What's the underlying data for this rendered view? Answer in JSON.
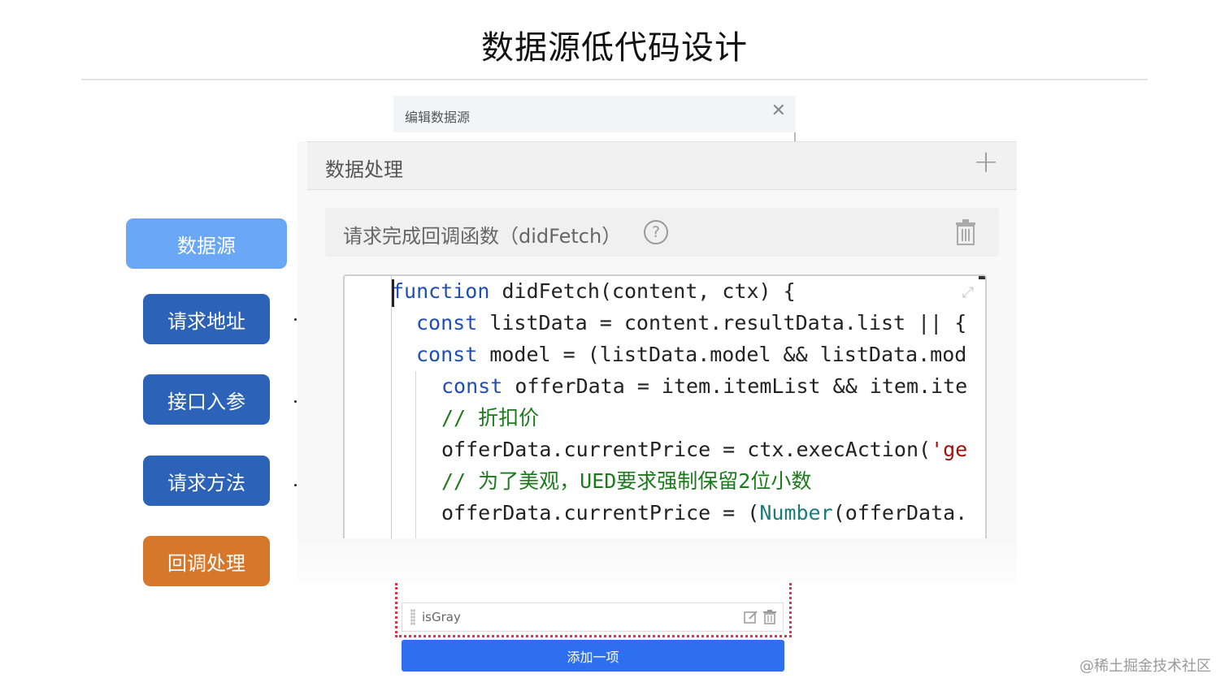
{
  "slide": {
    "title": "数据源低代码设计"
  },
  "nav": {
    "items": [
      {
        "label": "数据源",
        "color": "#6aa8f7"
      },
      {
        "label": "请求地址",
        "color": "#2c63b8"
      },
      {
        "label": "接口入参",
        "color": "#2c63b8"
      },
      {
        "label": "请求方法",
        "color": "#2c63b8"
      },
      {
        "label": "回调处理",
        "color": "#d6782c"
      }
    ]
  },
  "dialog": {
    "title": "编辑数据源",
    "close_icon": "close-icon"
  },
  "panel": {
    "title": "数据处理",
    "add_icon": "plus-icon",
    "section_title": "请求完成回调函数（didFetch）",
    "help_icon": "question-circle-icon",
    "delete_icon": "trash-icon"
  },
  "editor": {
    "expand_icon": "expand-icon",
    "lines": [
      {
        "kw": "function",
        "rest": " didFetch(content, ctx) {"
      },
      {
        "kw": "const",
        "rest": " listData = content.resultData.list || {"
      },
      {
        "kw": "const",
        "rest": " model = (listData.model && listData.mod"
      },
      {
        "kw": "const",
        "rest": " offerData = item.itemList && item.ite"
      },
      {
        "comment": "// 折扣价"
      },
      {
        "text": "offerData.currentPrice = ctx.execAction(",
        "str": "'ge"
      },
      {
        "comment": "// 为了美观，UED要求强制保留2位小数"
      },
      {
        "text": "offerData.currentPrice = (",
        "type": "Number",
        "rest": "(offerData."
      }
    ]
  },
  "list": {
    "item_label": "isGray",
    "edit_icon": "edit-icon",
    "delete_icon": "trash-icon"
  },
  "add_button": {
    "label": "添加一项"
  },
  "watermark": "@稀土掘金技术社区"
}
